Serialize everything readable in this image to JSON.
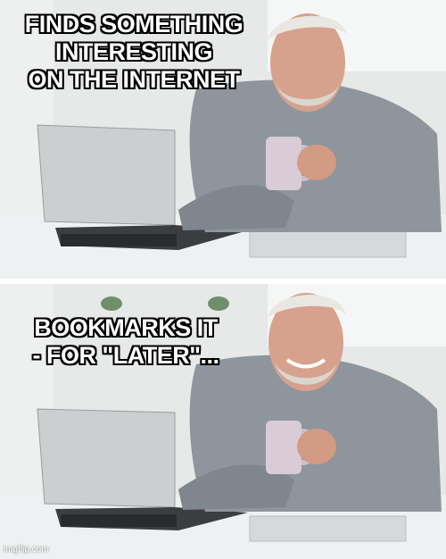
{
  "captions": {
    "top": [
      "FINDS SOMETHING",
      "INTERESTING",
      "ON THE INTERNET"
    ],
    "bottom": [
      "BOOKMARKS IT",
      "- FOR \"LATER\"..."
    ]
  },
  "watermark": "imgflip.com",
  "colors": {
    "caption_text": "#ffffff",
    "caption_outline": "#000000",
    "wall": "#e9eceb",
    "window": "#f6f8f6",
    "shirt": "#8e959c",
    "skin": "#d9a48f",
    "hair": "#e8e6e0",
    "laptop": "#c9cacc",
    "mug": "#d9ccd6",
    "desk": "#f1f3f3"
  }
}
